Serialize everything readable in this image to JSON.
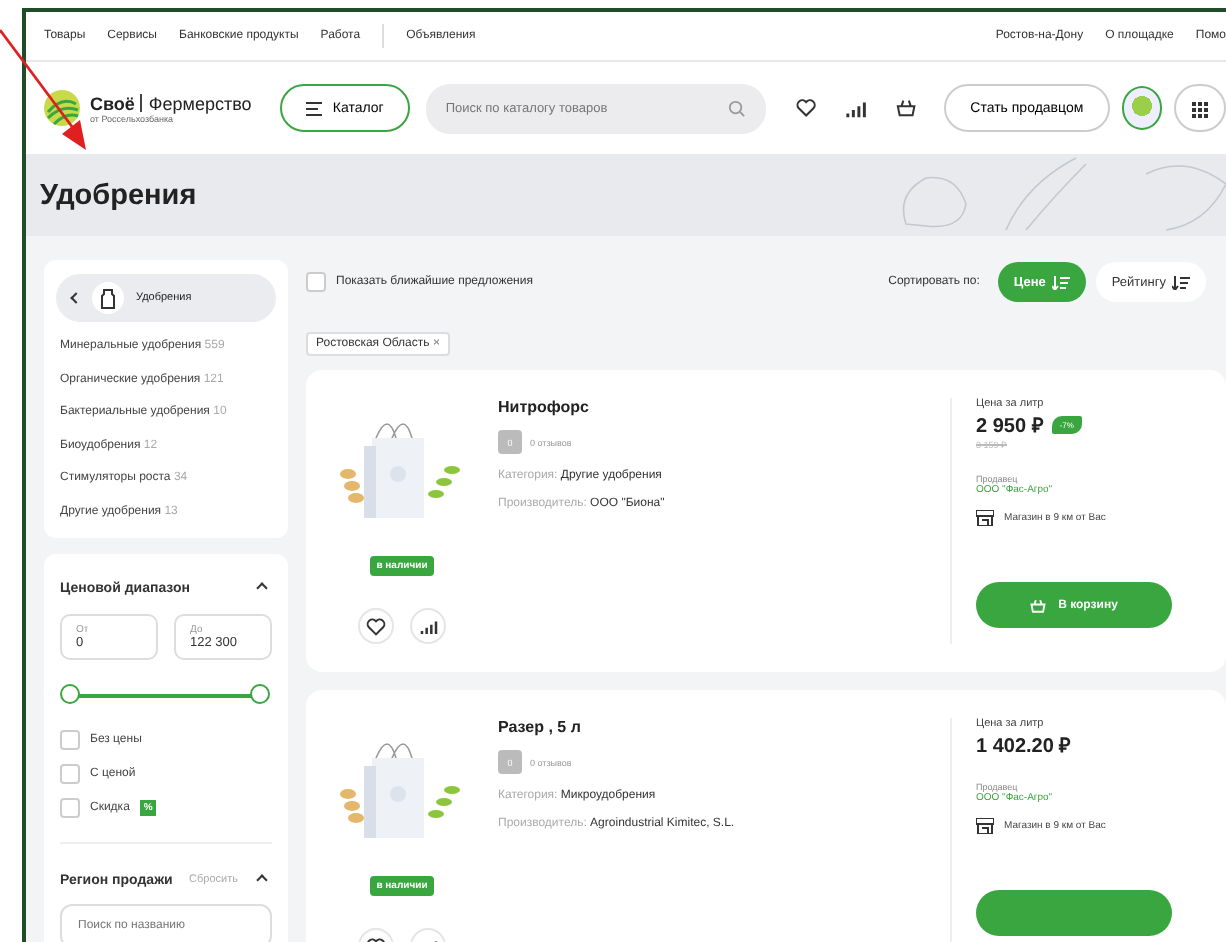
{
  "top_nav": {
    "links": [
      "Товары",
      "Сервисы",
      "Банковские продукты",
      "Работа"
    ],
    "announcements": "Объявления",
    "right_links": [
      "Ростов-на-Дону",
      "О площадке",
      "Помо"
    ]
  },
  "header": {
    "logo_name": "Своё",
    "logo_product": "Фермерство",
    "logo_subtitle": "от Россельхозбанка",
    "catalog_button": "Каталог",
    "search": {
      "placeholder": "Поиск по каталогу товаров"
    },
    "seller_button": "Стать продавцом"
  },
  "page_title": "Удобрения",
  "sidebar": {
    "category": "Удобрения",
    "subcategories": [
      {
        "label": "Минеральные удобрения",
        "count": "559"
      },
      {
        "label": "Органические удобрения",
        "count": "121"
      },
      {
        "label": "Бактериальные удобрения",
        "count": "10"
      },
      {
        "label": "Биоудобрения",
        "count": "12"
      },
      {
        "label": "Стимуляторы роста",
        "count": "34"
      },
      {
        "label": "Другие удобрения",
        "count": "13"
      }
    ],
    "price_filter": {
      "title": "Ценовой диапазон",
      "from": {
        "label": "От",
        "value": "0"
      },
      "to": {
        "label": "До",
        "value": "122 300"
      },
      "thumbs": [
        {
          "level": 0
        },
        {
          "level": 1
        }
      ],
      "checkboxes": [
        {
          "label": "Без цены",
          "checked": false
        },
        {
          "label": "С ценой",
          "checked": false
        },
        {
          "label": "Скидка",
          "checked": false,
          "badge": "%"
        }
      ]
    },
    "region": {
      "title": "Регион продажи",
      "reset": "Сбросить",
      "search": {
        "placeholder": "Поиск по названию"
      }
    }
  },
  "toolbar": {
    "nearby": {
      "label": "Показать ближайшие предложения",
      "checked": false
    },
    "sort_label": "Сортировать по:",
    "sort_options": [
      {
        "label": "Цене",
        "selected": true
      },
      {
        "label": "Рейтингу",
        "selected": false
      }
    ],
    "chips": [
      {
        "label": "Ростовская Область",
        "remove": "×"
      }
    ]
  },
  "products": [
    {
      "name": "Нитрофорс",
      "rating": "0",
      "reviews": "0 отзывов",
      "category_label": "Категория:",
      "category": "Другие удобрения",
      "maker_label": "Производитель:",
      "maker": "ООО \"Биона\"",
      "stock": "в наличии",
      "price_label": "Цена за литр",
      "price": "2 950 ₽",
      "discount": "-7%",
      "old_price": "3 159 ₽",
      "seller_label": "Продавец",
      "seller": "ООО \"Фас-Агро\"",
      "distance": "Магазин в 9 км от Вас",
      "cart_button": "В корзину"
    },
    {
      "name": "Разер , 5 л",
      "rating": "0",
      "reviews": "0 отзывов",
      "category_label": "Категория:",
      "category": "Микроудобрения",
      "maker_label": "Производитель:",
      "maker": "Agroindustrial Kimitec, S.L.",
      "stock": "в наличии",
      "price_label": "Цена за литр",
      "price": "1 402.20 ₽",
      "seller_label": "Продавец",
      "seller": "ООО \"Фас-Агро\"",
      "distance": "Магазин в 9 км от Вас"
    }
  ]
}
